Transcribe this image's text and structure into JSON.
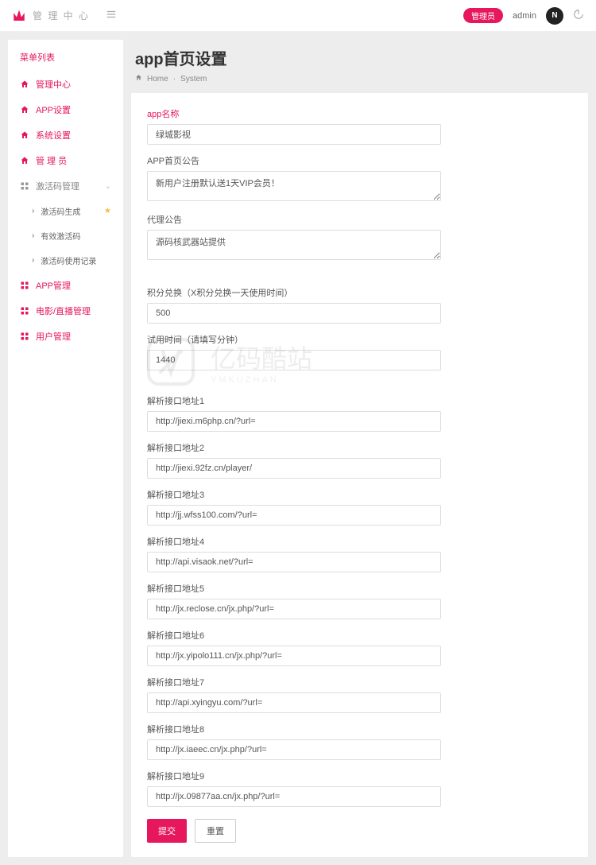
{
  "header": {
    "brand": "管 理 中 心",
    "badge": "管理员",
    "username": "admin",
    "avatar_letter": "N"
  },
  "sidebar": {
    "title": "菜单列表",
    "items": [
      {
        "label": "管理中心",
        "icon": "home"
      },
      {
        "label": "APP设置",
        "icon": "home"
      },
      {
        "label": "系统设置",
        "icon": "home"
      },
      {
        "label": "管 理 员",
        "icon": "home"
      }
    ],
    "group": {
      "label": "激活码管理",
      "icon": "grid"
    },
    "subitems": [
      {
        "label": "激活码生成",
        "star": true
      },
      {
        "label": "有效激活码"
      },
      {
        "label": "激活码使用记录"
      }
    ],
    "items2": [
      {
        "label": "APP管理",
        "icon": "grid"
      },
      {
        "label": "电影/直播管理",
        "icon": "grid"
      },
      {
        "label": "用户管理",
        "icon": "grid"
      }
    ]
  },
  "page": {
    "title": "app首页设置",
    "breadcrumb_home": "Home",
    "breadcrumb_current": "System"
  },
  "form": {
    "app_name_label": "app名称",
    "app_name_value": "绿城影视",
    "announce_label": "APP首页公告",
    "announce_value": "新用户注册默认送1天VIP会员！",
    "agent_label": "代理公告",
    "agent_value": "源码核武器站提供",
    "points_label": "积分兑换（X积分兑换一天使用时间）",
    "points_value": "500",
    "trial_label": "试用时间（请填写分钟）",
    "trial_value": "1440",
    "parse1_label": "解析接口地址1",
    "parse1_value": "http://jiexi.m6php.cn/?url=",
    "parse2_label": "解析接口地址2",
    "parse2_value": "http://jiexi.92fz.cn/player/",
    "parse3_label": "解析接口地址3",
    "parse3_value": "http://jj.wfss100.com/?url=",
    "parse4_label": "解析接口地址4",
    "parse4_value": "http://api.visaok.net/?url=",
    "parse5_label": "解析接口地址5",
    "parse5_value": "http://jx.reclose.cn/jx.php/?url=",
    "parse6_label": "解析接口地址6",
    "parse6_value": "http://jx.yipolo111.cn/jx.php/?url=",
    "parse7_label": "解析接口地址7",
    "parse7_value": "http://api.xyingyu.com/?url=",
    "parse8_label": "解析接口地址8",
    "parse8_value": "http://jx.iaeec.cn/jx.php/?url=",
    "parse9_label": "解析接口地址9",
    "parse9_value": "http://jx.09877aa.cn/jx.php/?url=",
    "submit": "提交",
    "reset": "重置"
  },
  "watermark": {
    "cn": "亿码酷站",
    "en": "YMKUZHAN"
  }
}
